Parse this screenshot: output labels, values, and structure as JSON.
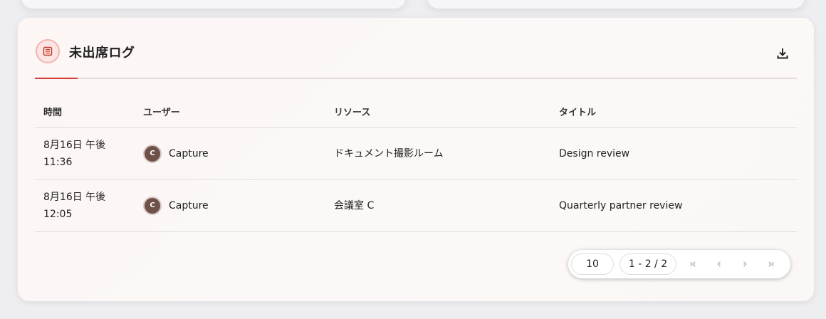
{
  "card": {
    "title": "未出席ログ",
    "title_icon": "list-icon",
    "download_icon": "download-icon",
    "accent": "#d93a3a"
  },
  "table": {
    "headers": {
      "time": "時間",
      "user": "ユーザー",
      "resource": "リソース",
      "title": "タイトル"
    },
    "rows": [
      {
        "date": "8月16日 午後",
        "time": "11:36",
        "avatar": "C",
        "user": "Capture",
        "resource": "ドキュメント撮影ルーム",
        "title": "Design review"
      },
      {
        "date": "8月16日 午後",
        "time": "12:05",
        "avatar": "C",
        "user": "Capture",
        "resource": "会議室 C",
        "title": "Quarterly partner review"
      }
    ]
  },
  "pagination": {
    "rows_per_page": "10",
    "range": "1 - 2 / 2",
    "icons": [
      "first-page-icon",
      "prev-page-icon",
      "next-page-icon",
      "last-page-icon"
    ]
  }
}
